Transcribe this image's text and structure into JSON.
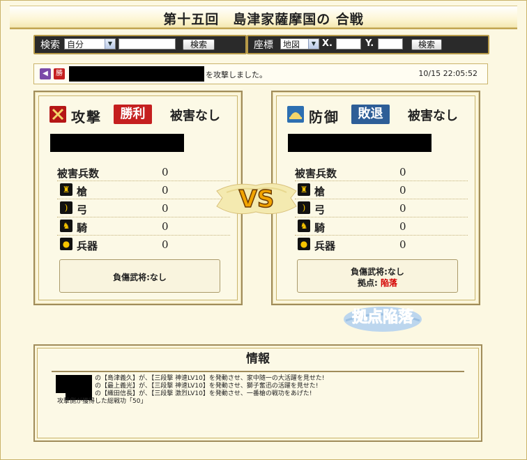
{
  "title": "第十五回　島津家薩摩国の 合戦",
  "search": {
    "label": "検索",
    "scope_value": "自分",
    "button": "検索"
  },
  "coords": {
    "label": "座標",
    "map_value": "地図",
    "x_label": "X.",
    "y_label": "Y.",
    "button": "検索"
  },
  "message": {
    "icon_win": "勝",
    "text": "を攻撃しました。",
    "time": "10/15 22:05:52"
  },
  "attack": {
    "role": "攻撃",
    "result": "勝利",
    "damage": "被害なし",
    "rows": [
      {
        "label": "被害兵数",
        "value": "0"
      },
      {
        "label": "槍",
        "value": "0"
      },
      {
        "label": "弓",
        "value": "0"
      },
      {
        "label": "騎",
        "value": "0"
      },
      {
        "label": "兵器",
        "value": "0"
      }
    ],
    "injured_label": "負傷武将:なし"
  },
  "defense": {
    "role": "防御",
    "result": "敗退",
    "damage": "被害なし",
    "rows": [
      {
        "label": "被害兵数",
        "value": "0"
      },
      {
        "label": "槍",
        "value": "0"
      },
      {
        "label": "弓",
        "value": "0"
      },
      {
        "label": "騎",
        "value": "0"
      },
      {
        "label": "兵器",
        "value": "0"
      }
    ],
    "injured_label": "負傷武将:なし",
    "base_label": "拠点:",
    "base_value": "陥落"
  },
  "vs_text": "VS",
  "fall_stamp": "拠点陥落",
  "info": {
    "heading": "情報",
    "lines": [
      "の【島津義久】が、【三段撃 神速LV10】を発動させ、家中随一の大活躍を見せた!",
      "の【最上義光】が、【三段撃 神速LV10】を発動させ、獅子奮迅の活躍を見せた!",
      "の【織田信長】が、【三段撃 激烈LV10】を発動させ、一番槍の戦功をあげた!",
      "攻撃側が獲得した総戦功「50」"
    ]
  },
  "colors": {
    "win_badge": "#c51f1f",
    "lose_badge": "#2e5e97",
    "gold": "#c2a653",
    "red_text": "#d40000"
  }
}
